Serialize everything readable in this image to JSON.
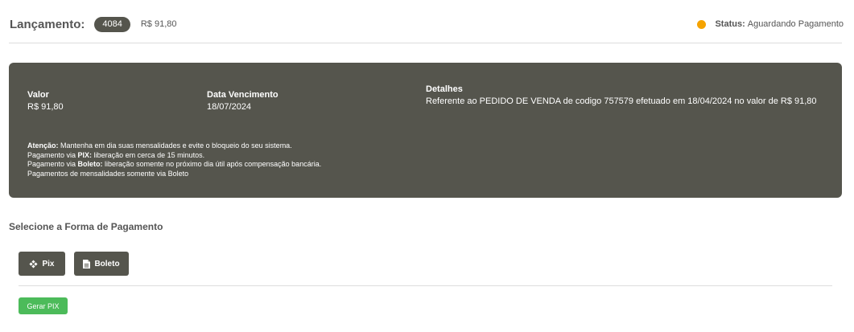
{
  "header": {
    "lancamento_label": "Lançamento:",
    "lancamento_id": "4084",
    "lancamento_valor": "R$ 91,80",
    "status_label": "Status:",
    "status_value": "Aguardando Pagamento",
    "status_color": "#f5a300"
  },
  "panel": {
    "valor_label": "Valor",
    "valor_value": "R$ 91,80",
    "vencimento_label": "Data Vencimento",
    "vencimento_value": "18/07/2024",
    "detalhes_label": "Detalhes",
    "detalhes_value": "Referente ao PEDIDO DE VENDA de codigo 757579 efetuado em 18/04/2024 no valor de R$ 91,80",
    "notes": {
      "atencao_label": "Atenção:",
      "atencao_text": " Mantenha em dia suas mensalidades e evite o bloqueio do seu sistema.",
      "pix_prefix": "Pagamento via ",
      "pix_label": "PIX:",
      "pix_text": " liberação em cerca de 15 minutos.",
      "boleto_prefix": "Pagamento via ",
      "boleto_label": "Boleto:",
      "boleto_text": " liberação somente no próximo dia útil após compensação bancária.",
      "mensalidades_text": "Pagamentos de mensalidades somente via Boleto"
    },
    "background_color": "#55554d"
  },
  "payment": {
    "section_title": "Selecione a Forma de Pagamento",
    "pix_label": "Pix",
    "boleto_label": "Boleto",
    "gerar_label": "Gerar PIX",
    "gerar_color": "#4cbb5a"
  }
}
